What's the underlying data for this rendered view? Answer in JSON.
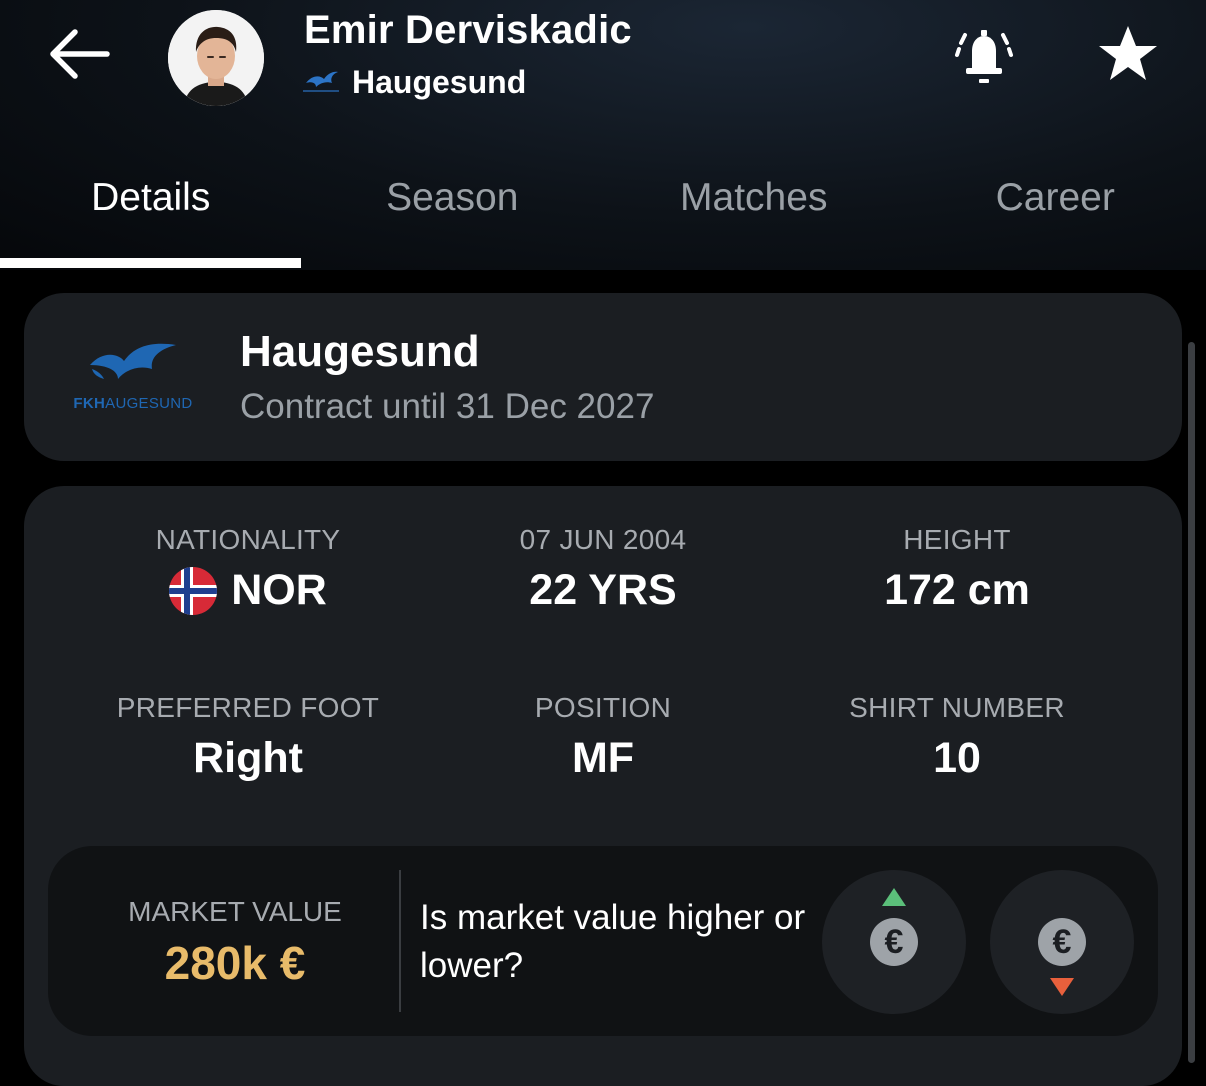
{
  "header": {
    "player_name": "Emir Derviskadic",
    "club_name": "Haugesund",
    "icons": {
      "back": "arrow-left-icon",
      "bell": "bell-ringing-icon",
      "star": "star-icon"
    }
  },
  "tabs": [
    {
      "label": "Details",
      "active": true
    },
    {
      "label": "Season",
      "active": false
    },
    {
      "label": "Matches",
      "active": false
    },
    {
      "label": "Career",
      "active": false
    }
  ],
  "club_card": {
    "logo_text_bold": "FKH",
    "logo_text_rest": "AUGESUND",
    "club": "Haugesund",
    "contract": "Contract until 31 Dec 2027"
  },
  "stats": {
    "nationality": {
      "label": "NATIONALITY",
      "value": "NOR"
    },
    "birth": {
      "label": "07 JUN 2004",
      "value": "22 YRS"
    },
    "height": {
      "label": "HEIGHT",
      "value": "172 cm"
    },
    "foot": {
      "label": "PREFERRED FOOT",
      "value": "Right"
    },
    "position": {
      "label": "POSITION",
      "value": "MF"
    },
    "shirt": {
      "label": "SHIRT NUMBER",
      "value": "10"
    }
  },
  "market": {
    "label": "MARKET VALUE",
    "value": "280k €",
    "question": "Is market value higher or lower?",
    "euro_symbol": "€"
  },
  "colors": {
    "accent_gold": "#e8bb6a",
    "up_green": "#5bbf7a",
    "down_red": "#e8603c",
    "club_blue": "#1f67b3"
  }
}
